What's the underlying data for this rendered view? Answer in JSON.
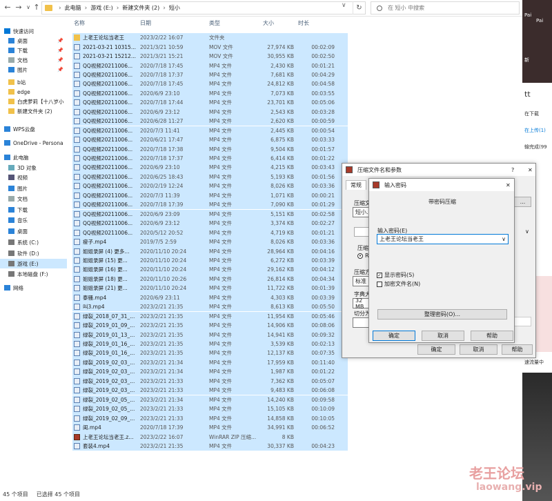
{
  "address": {
    "path": [
      "此电脑",
      "游戏 (E:)",
      "新建文件夹 (2)",
      "短小"
    ],
    "search_placeholder": "在 短小 中搜索"
  },
  "sidebar": {
    "items": [
      {
        "label": "快速访问",
        "icon": "star-icon",
        "pin": false
      },
      {
        "label": "桌面",
        "icon": "desktop-icon",
        "pin": true
      },
      {
        "label": "下载",
        "icon": "download-icon",
        "pin": true
      },
      {
        "label": "文档",
        "icon": "document-icon",
        "pin": true
      },
      {
        "label": "图片",
        "icon": "picture-icon",
        "pin": true
      },
      {
        "label": "b站",
        "icon": "folder-icon",
        "pin": false
      },
      {
        "label": "edge",
        "icon": "folder-icon",
        "pin": false
      },
      {
        "label": "白虎萝莉【十八岁小",
        "icon": "folder-icon",
        "pin": false
      },
      {
        "label": "新建文件夹 (2)",
        "icon": "folder-icon",
        "pin": false
      },
      {
        "label": "WPS云盘",
        "icon": "cloud-icon",
        "pin": false
      },
      {
        "label": "OneDrive - Persona",
        "icon": "onedrive-icon",
        "pin": false
      },
      {
        "label": "此电脑",
        "icon": "computer-icon",
        "pin": false
      },
      {
        "label": "3D 对象",
        "icon": "cube-icon",
        "pin": false
      },
      {
        "label": "视频",
        "icon": "video-icon",
        "pin": false
      },
      {
        "label": "图片",
        "icon": "picture-icon",
        "pin": false
      },
      {
        "label": "文档",
        "icon": "document-icon",
        "pin": false
      },
      {
        "label": "下载",
        "icon": "download-icon",
        "pin": false
      },
      {
        "label": "音乐",
        "icon": "music-icon",
        "pin": false
      },
      {
        "label": "桌面",
        "icon": "desktop-icon",
        "pin": false
      },
      {
        "label": "系统 (C:)",
        "icon": "drive-icon",
        "pin": false
      },
      {
        "label": "软件 (D:)",
        "icon": "drive-icon",
        "pin": false
      },
      {
        "label": "游戏 (E:)",
        "icon": "drive-icon",
        "pin": false
      },
      {
        "label": "本地磁盘 (F:)",
        "icon": "drive-icon",
        "pin": false
      },
      {
        "label": "网络",
        "icon": "network-icon",
        "pin": false
      }
    ]
  },
  "columns": [
    "名称",
    "日期",
    "类型",
    "大小",
    "时长"
  ],
  "files": [
    {
      "name": "上老王论坛当老王",
      "date": "2023/2/22 16:07",
      "type": "文件夹",
      "size": "",
      "dur": "",
      "icon": "fld"
    },
    {
      "name": "2021-03-21 10315...",
      "date": "2021/3/21 10:59",
      "type": "MOV 文件",
      "size": "27,974 KB",
      "dur": "00:02:09",
      "icon": "mp4"
    },
    {
      "name": "2021-03-21 15212...",
      "date": "2021/3/21 15:21",
      "type": "MOV 文件",
      "size": "30,955 KB",
      "dur": "00:02:50",
      "icon": "mp4"
    },
    {
      "name": "QQ视频20211006...",
      "date": "2020/7/18 17:45",
      "type": "MP4 文件",
      "size": "2,430 KB",
      "dur": "00:01:21",
      "icon": "mp4"
    },
    {
      "name": "QQ视频20211006...",
      "date": "2020/7/18 17:37",
      "type": "MP4 文件",
      "size": "7,681 KB",
      "dur": "00:04:29",
      "icon": "mp4"
    },
    {
      "name": "QQ视频20211006...",
      "date": "2020/7/18 17:45",
      "type": "MP4 文件",
      "size": "24,812 KB",
      "dur": "00:04:58",
      "icon": "mp4"
    },
    {
      "name": "QQ视频20211006...",
      "date": "2020/6/9 23:10",
      "type": "MP4 文件",
      "size": "7,073 KB",
      "dur": "00:03:55",
      "icon": "mp4"
    },
    {
      "name": "QQ视频20211006...",
      "date": "2020/7/18 17:44",
      "type": "MP4 文件",
      "size": "23,701 KB",
      "dur": "00:05:06",
      "icon": "mp4"
    },
    {
      "name": "QQ视频20211006...",
      "date": "2020/6/9 23:12",
      "type": "MP4 文件",
      "size": "2,543 KB",
      "dur": "00:03:28",
      "icon": "mp4"
    },
    {
      "name": "QQ视频20211006...",
      "date": "2020/6/28 11:27",
      "type": "MP4 文件",
      "size": "2,620 KB",
      "dur": "00:00:59",
      "icon": "mp4"
    },
    {
      "name": "QQ视频20211006...",
      "date": "2020/7/3 11:41",
      "type": "MP4 文件",
      "size": "2,445 KB",
      "dur": "00:00:54",
      "icon": "mp4"
    },
    {
      "name": "QQ视频20211006...",
      "date": "2020/6/21 17:47",
      "type": "MP4 文件",
      "size": "6,875 KB",
      "dur": "00:03:33",
      "icon": "mp4"
    },
    {
      "name": "QQ视频20211006...",
      "date": "2020/7/18 17:38",
      "type": "MP4 文件",
      "size": "9,504 KB",
      "dur": "00:01:57",
      "icon": "mp4"
    },
    {
      "name": "QQ视频20211006...",
      "date": "2020/7/18 17:37",
      "type": "MP4 文件",
      "size": "6,414 KB",
      "dur": "00:01:22",
      "icon": "mp4"
    },
    {
      "name": "QQ视频20211006...",
      "date": "2020/6/9 23:10",
      "type": "MP4 文件",
      "size": "4,215 KB",
      "dur": "00:03:43",
      "icon": "mp4"
    },
    {
      "name": "QQ视频20211006...",
      "date": "2020/6/25 18:43",
      "type": "MP4 文件",
      "size": "5,193 KB",
      "dur": "00:01:56",
      "icon": "mp4"
    },
    {
      "name": "QQ视频20211006...",
      "date": "2020/2/19 12:24",
      "type": "MP4 文件",
      "size": "8,026 KB",
      "dur": "00:03:36",
      "icon": "mp4"
    },
    {
      "name": "QQ视频20211006...",
      "date": "2020/7/3 11:39",
      "type": "MP4 文件",
      "size": "1,071 KB",
      "dur": "00:00:21",
      "icon": "mp4"
    },
    {
      "name": "QQ视频20211006...",
      "date": "2020/7/18 17:39",
      "type": "MP4 文件",
      "size": "7,090 KB",
      "dur": "00:01:29",
      "icon": "mp4"
    },
    {
      "name": "QQ视频20211006...",
      "date": "2020/6/9 23:09",
      "type": "MP4 文件",
      "size": "5,151 KB",
      "dur": "00:02:58",
      "icon": "mp4"
    },
    {
      "name": "QQ视频20211006...",
      "date": "2020/6/9 23:12",
      "type": "MP4 文件",
      "size": "3,374 KB",
      "dur": "00:02:27",
      "icon": "mp4"
    },
    {
      "name": "QQ视频20211006...",
      "date": "2020/5/12 20:52",
      "type": "MP4 文件",
      "size": "4,719 KB",
      "dur": "00:01:21",
      "icon": "mp4"
    },
    {
      "name": "瘦子.mp4",
      "date": "2019/7/5 2:59",
      "type": "MP4 文件",
      "size": "8,026 KB",
      "dur": "00:03:36",
      "icon": "mp4"
    },
    {
      "name": "姐姐录屏 (4) 更多...",
      "date": "2020/11/10 20:24",
      "type": "MP4 文件",
      "size": "28,964 KB",
      "dur": "00:04:16",
      "icon": "mp4"
    },
    {
      "name": "姐姐录屏 (15) 更...",
      "date": "2020/11/10 20:24",
      "type": "MP4 文件",
      "size": "6,272 KB",
      "dur": "00:03:39",
      "icon": "mp4"
    },
    {
      "name": "姐姐录屏 (16) 更...",
      "date": "2020/11/10 20:24",
      "type": "MP4 文件",
      "size": "29,162 KB",
      "dur": "00:04:12",
      "icon": "mp4"
    },
    {
      "name": "姐姐录屏 (18) 更...",
      "date": "2020/11/10 20:26",
      "type": "MP4 文件",
      "size": "26,814 KB",
      "dur": "00:04:34",
      "icon": "mp4"
    },
    {
      "name": "姐姐录屏 (21) 更...",
      "date": "2020/11/10 20:24",
      "type": "MP4 文件",
      "size": "11,722 KB",
      "dur": "00:01:39",
      "icon": "mp4"
    },
    {
      "name": "泰骚.mp4",
      "date": "2020/6/9 23:11",
      "type": "MP4 文件",
      "size": "4,303 KB",
      "dur": "00:03:39",
      "icon": "mp4"
    },
    {
      "name": "叫3.mp4",
      "date": "2023/2/21 21:35",
      "type": "MP4 文件",
      "size": "8,613 KB",
      "dur": "00:05:50",
      "icon": "mp4"
    },
    {
      "name": "绿裂_2018_07_31_...",
      "date": "2023/2/21 21:35",
      "type": "MP4 文件",
      "size": "11,954 KB",
      "dur": "00:05:46",
      "icon": "mp4"
    },
    {
      "name": "绿裂_2019_01_09_...",
      "date": "2023/2/21 21:35",
      "type": "MP4 文件",
      "size": "14,906 KB",
      "dur": "00:08:06",
      "icon": "mp4"
    },
    {
      "name": "绿裂_2019_01_13_...",
      "date": "2023/2/21 21:35",
      "type": "MP4 文件",
      "size": "14,941 KB",
      "dur": "00:09:32",
      "icon": "mp4"
    },
    {
      "name": "绿裂_2019_01_16_...",
      "date": "2023/2/21 21:35",
      "type": "MP4 文件",
      "size": "3,539 KB",
      "dur": "00:02:13",
      "icon": "mp4"
    },
    {
      "name": "绿裂_2019_01_16_...",
      "date": "2023/2/21 21:35",
      "type": "MP4 文件",
      "size": "12,137 KB",
      "dur": "00:07:35",
      "icon": "mp4"
    },
    {
      "name": "绿裂_2019_02_03_...",
      "date": "2023/2/21 21:34",
      "type": "MP4 文件",
      "size": "17,959 KB",
      "dur": "00:11:40",
      "icon": "mp4"
    },
    {
      "name": "绿裂_2019_02_03_...",
      "date": "2023/2/21 21:34",
      "type": "MP4 文件",
      "size": "1,987 KB",
      "dur": "00:01:22",
      "icon": "mp4"
    },
    {
      "name": "绿裂_2019_02_03_...",
      "date": "2023/2/21 21:33",
      "type": "MP4 文件",
      "size": "7,362 KB",
      "dur": "00:05:07",
      "icon": "mp4"
    },
    {
      "name": "绿裂_2019_02_03_...",
      "date": "2023/2/21 21:33",
      "type": "MP4 文件",
      "size": "9,483 KB",
      "dur": "00:06:08",
      "icon": "mp4"
    },
    {
      "name": "绿裂_2019_02_05_...",
      "date": "2023/2/21 21:34",
      "type": "MP4 文件",
      "size": "14,240 KB",
      "dur": "00:09:58",
      "icon": "mp4"
    },
    {
      "name": "绿裂_2019_02_05_...",
      "date": "2023/2/21 21:33",
      "type": "MP4 文件",
      "size": "15,105 KB",
      "dur": "00:10:09",
      "icon": "mp4"
    },
    {
      "name": "绿裂_2019_02_09_...",
      "date": "2023/2/21 21:33",
      "type": "MP4 文件",
      "size": "14,858 KB",
      "dur": "00:10:05",
      "icon": "mp4"
    },
    {
      "name": "闺.mp4",
      "date": "2020/7/18 17:39",
      "type": "MP4 文件",
      "size": "34,991 KB",
      "dur": "00:06:52",
      "icon": "mp4"
    },
    {
      "name": "上老王论坛当老王.z...",
      "date": "2023/2/22 16:07",
      "type": "WinRAR ZIP 压缩...",
      "size": "8 KB",
      "dur": "",
      "icon": "zip"
    },
    {
      "name": "套装4.mp4",
      "date": "2023/2/21 21:35",
      "type": "MP4 文件",
      "size": "30,337 KB",
      "dur": "00:04:23",
      "icon": "mp4"
    }
  ],
  "status": {
    "count": "45 个项目",
    "selected": "已选择 45 个项目"
  },
  "archive_dialog": {
    "title": "压缩文件名和参数",
    "help": "?",
    "tab": "常规",
    "browse": "...",
    "labels": [
      "压缩文",
      "压缩",
      "压缩方",
      "字典大",
      "切分为"
    ],
    "name_value": "短小.r",
    "method": "标准",
    "dict": "32 MB",
    "radio": "RA",
    "ok": "确定",
    "cancel": "取消",
    "helpbtn": "帮助"
  },
  "pwd_dialog": {
    "title": "输入密码",
    "heading": "带密码压缩",
    "label": "输入密码(E)",
    "value": "上老王论坛当老王",
    "show_pwd": "显示密码(S)",
    "encrypt_names": "加密文件名(N)",
    "organize": "整理密码(O)...",
    "ok": "确定",
    "cancel": "取消",
    "help": "帮助"
  },
  "right_bg": {
    "t1": "Pai",
    "t2": "Pai",
    "t3": "新",
    "t4": "tt",
    "t5": "在下载",
    "t6": "在上传(1)",
    "t7": "输完成(99",
    "t8": "速流量中"
  },
  "watermark": {
    "logo": "老王论坛",
    "url": "laowang.vip"
  },
  "colors": {
    "selection": "#cce8ff",
    "folder": "#f1c14a",
    "accent": "#0078d7"
  }
}
